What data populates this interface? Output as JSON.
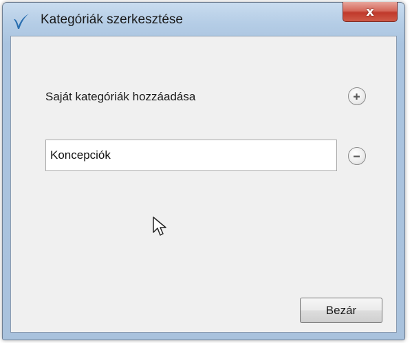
{
  "window": {
    "title": "Kategóriák szerkesztése",
    "close_glyph": "x",
    "app_icon": "check-logo-icon"
  },
  "dialog": {
    "add_label": "Saját kategóriák hozzáadása",
    "add_icon": "plus-circle-icon",
    "remove_icon": "minus-circle-icon",
    "category_input": {
      "value": "Koncepciók",
      "placeholder": ""
    },
    "close_button_label": "Bezár"
  },
  "colors": {
    "titlebar": "#b5cde6",
    "client_bg": "#f0f0f0",
    "close_red": "#c0392b",
    "logo_blue": "#2a6fb0"
  }
}
